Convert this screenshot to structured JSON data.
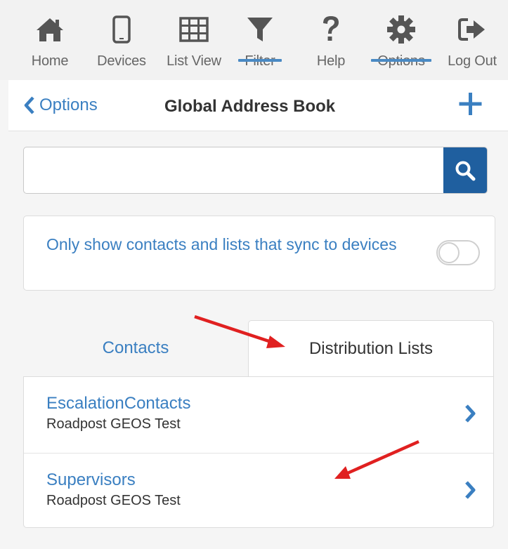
{
  "nav": {
    "items": [
      {
        "label": "Home",
        "icon": "home-icon"
      },
      {
        "label": "Devices",
        "icon": "phone-icon"
      },
      {
        "label": "List View",
        "icon": "grid-icon"
      },
      {
        "label": "Filter",
        "icon": "filter-icon",
        "active": true
      },
      {
        "label": "Help",
        "icon": "question-icon"
      },
      {
        "label": "Options",
        "icon": "gear-icon",
        "active": true
      },
      {
        "label": "Log Out",
        "icon": "logout-icon"
      }
    ]
  },
  "header": {
    "back_label": "Options",
    "title": "Global Address Book"
  },
  "search": {
    "value": "",
    "placeholder": ""
  },
  "sync": {
    "label": "Only show contacts and lists that sync to devices",
    "enabled": false
  },
  "tabs": [
    {
      "label": "Contacts",
      "selected": false
    },
    {
      "label": "Distribution Lists",
      "selected": true
    }
  ],
  "list": [
    {
      "title": "EscalationContacts",
      "subtitle": "Roadpost GEOS Test"
    },
    {
      "title": "Supervisors",
      "subtitle": "Roadpost GEOS Test"
    }
  ],
  "colors": {
    "accent": "#3a7fc1",
    "nav_icon": "#555555",
    "search_button": "#1f5f9f",
    "annotation_arrow": "#e02020"
  }
}
